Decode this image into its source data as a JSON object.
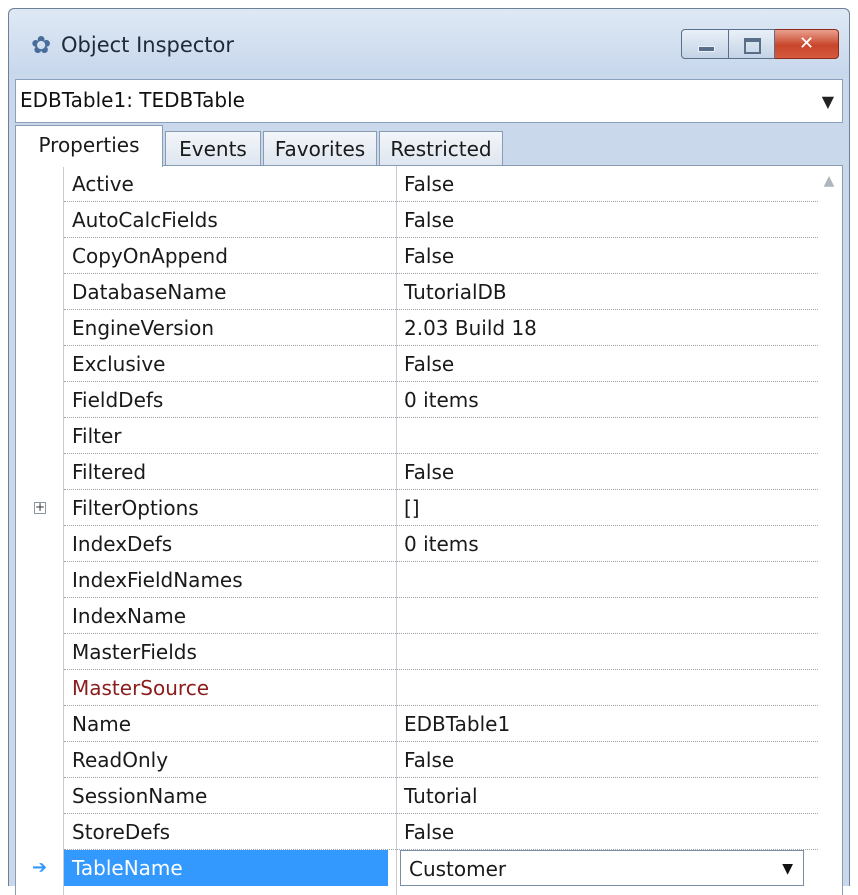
{
  "window": {
    "title": "Object Inspector",
    "app_icon": "object-inspector-icon",
    "min_glyph": "",
    "max_glyph": "",
    "close_glyph": "✕"
  },
  "object_selector": {
    "value": "EDBTable1: TEDBTable",
    "arrow": "▼"
  },
  "tabs": [
    {
      "label": "Properties",
      "active": true
    },
    {
      "label": "Events",
      "active": false
    },
    {
      "label": "Favorites",
      "active": false
    },
    {
      "label": "Restricted",
      "active": false
    }
  ],
  "properties": [
    {
      "name": "Active",
      "value": "False"
    },
    {
      "name": "AutoCalcFields",
      "value": "False"
    },
    {
      "name": "CopyOnAppend",
      "value": "False"
    },
    {
      "name": "DatabaseName",
      "value": "TutorialDB"
    },
    {
      "name": "EngineVersion",
      "value": "2.03 Build 18"
    },
    {
      "name": "Exclusive",
      "value": "False"
    },
    {
      "name": "FieldDefs",
      "value": "0 items"
    },
    {
      "name": "Filter",
      "value": ""
    },
    {
      "name": "Filtered",
      "value": "False"
    },
    {
      "name": "FilterOptions",
      "value": "[]",
      "expandable": true,
      "expander": "+"
    },
    {
      "name": "IndexDefs",
      "value": "0 items"
    },
    {
      "name": "IndexFieldNames",
      "value": ""
    },
    {
      "name": "IndexName",
      "value": ""
    },
    {
      "name": "MasterFields",
      "value": ""
    },
    {
      "name": "MasterSource",
      "value": "",
      "reference": true
    },
    {
      "name": "Name",
      "value": "EDBTable1"
    },
    {
      "name": "ReadOnly",
      "value": "False"
    },
    {
      "name": "SessionName",
      "value": "Tutorial"
    },
    {
      "name": "StoreDefs",
      "value": "False"
    },
    {
      "name": "TableName",
      "value": "Customer",
      "selected": true,
      "marker": "➔",
      "dropdown": "▼"
    }
  ],
  "colors": {
    "selection": "#3399ff",
    "reference_text": "#8b1c1c",
    "window_frame": "#c9d8ea"
  }
}
